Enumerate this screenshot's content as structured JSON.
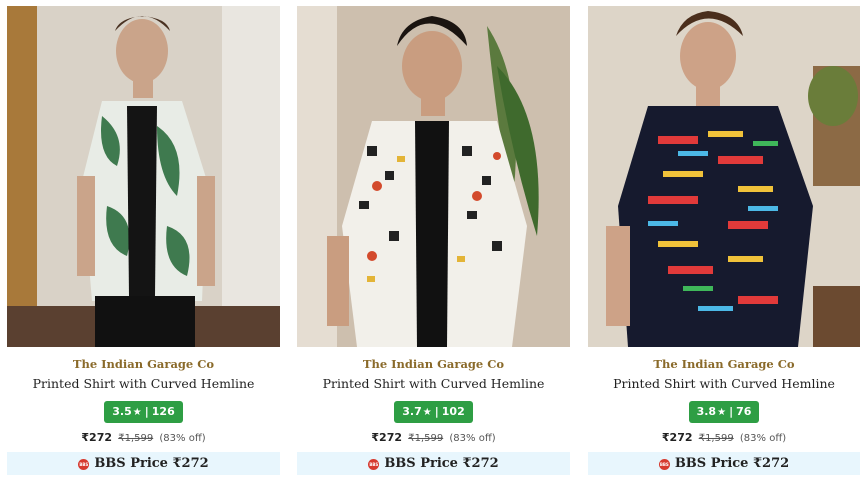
{
  "products": [
    {
      "brand": "The Indian Garage Co",
      "title": "Printed Shirt with Curved Hemline",
      "rating": "3.5",
      "reviews": "126",
      "price": "₹272",
      "mrp": "₹1,599",
      "discount": "(83% off)",
      "bbs_label": "BBS Price ₹272",
      "image_alt": "Model in green and white printed shirt"
    },
    {
      "brand": "The Indian Garage Co",
      "title": "Printed Shirt with Curved Hemline",
      "rating": "3.7",
      "reviews": "102",
      "price": "₹272",
      "mrp": "₹1,599",
      "discount": "(83% off)",
      "bbs_label": "BBS Price ₹272",
      "image_alt": "Model in white graphic printed shirt"
    },
    {
      "brand": "The Indian Garage Co",
      "title": "Printed Shirt with Curved Hemline",
      "rating": "3.8",
      "reviews": "76",
      "price": "₹272",
      "mrp": "₹1,599",
      "discount": "(83% off)",
      "bbs_label": "BBS Price ₹272",
      "image_alt": "Model in dark multicolor printed shirt"
    }
  ],
  "icons": {
    "star": "star-icon",
    "bbs": "bbs-badge-icon"
  },
  "colors": {
    "brand_text": "#8a6a2a",
    "rating_bg": "#2e9e44",
    "bbs_bg": "#e8f6fd",
    "bbs_icon": "#d63a2f"
  }
}
